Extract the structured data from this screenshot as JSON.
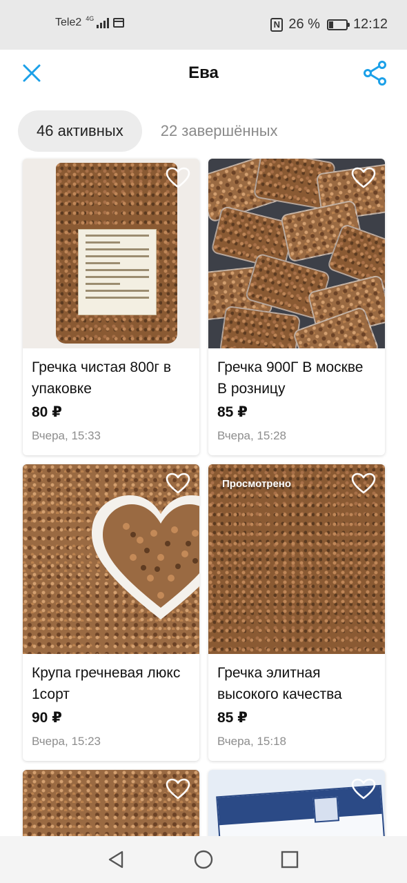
{
  "status_bar": {
    "carrier": "Tele2",
    "network": "4G",
    "battery": "26 %",
    "battery_level": 0.26,
    "time": "12:12"
  },
  "header": {
    "title": "Ева",
    "close_icon": "close-icon",
    "share_icon": "share-icon"
  },
  "tabs": [
    {
      "label": "46 активных",
      "active": true
    },
    {
      "label": "22 завершённых",
      "active": false
    }
  ],
  "listings": [
    {
      "title": "Гречка чистая 800г в упаковке",
      "price": "80 ₽",
      "date": "Вчера, 15:33",
      "badge": ""
    },
    {
      "title": "Гречка 900Г В москве В розницу",
      "price": "85 ₽",
      "date": "Вчера, 15:28",
      "badge": ""
    },
    {
      "title": "Крупа гречневая люкс 1сорт",
      "price": "90 ₽",
      "date": "Вчера, 15:23",
      "badge": ""
    },
    {
      "title": "Гречка элитная высокого качества",
      "price": "85 ₽",
      "date": "Вчера, 15:18",
      "badge": "Просмотрено"
    },
    {
      "title": "",
      "price": "",
      "date": "",
      "badge": ""
    },
    {
      "title": "",
      "price": "",
      "date": "",
      "badge": ""
    }
  ],
  "nav": {
    "back_icon": "back-triangle-icon",
    "home_icon": "home-circle-icon",
    "recents_icon": "recents-square-icon"
  },
  "colors": {
    "accent": "#1ba0e8",
    "tab_active_bg": "#ececec",
    "status_bar_bg": "#e9e9e9",
    "muted_text": "#8d8d8d"
  }
}
